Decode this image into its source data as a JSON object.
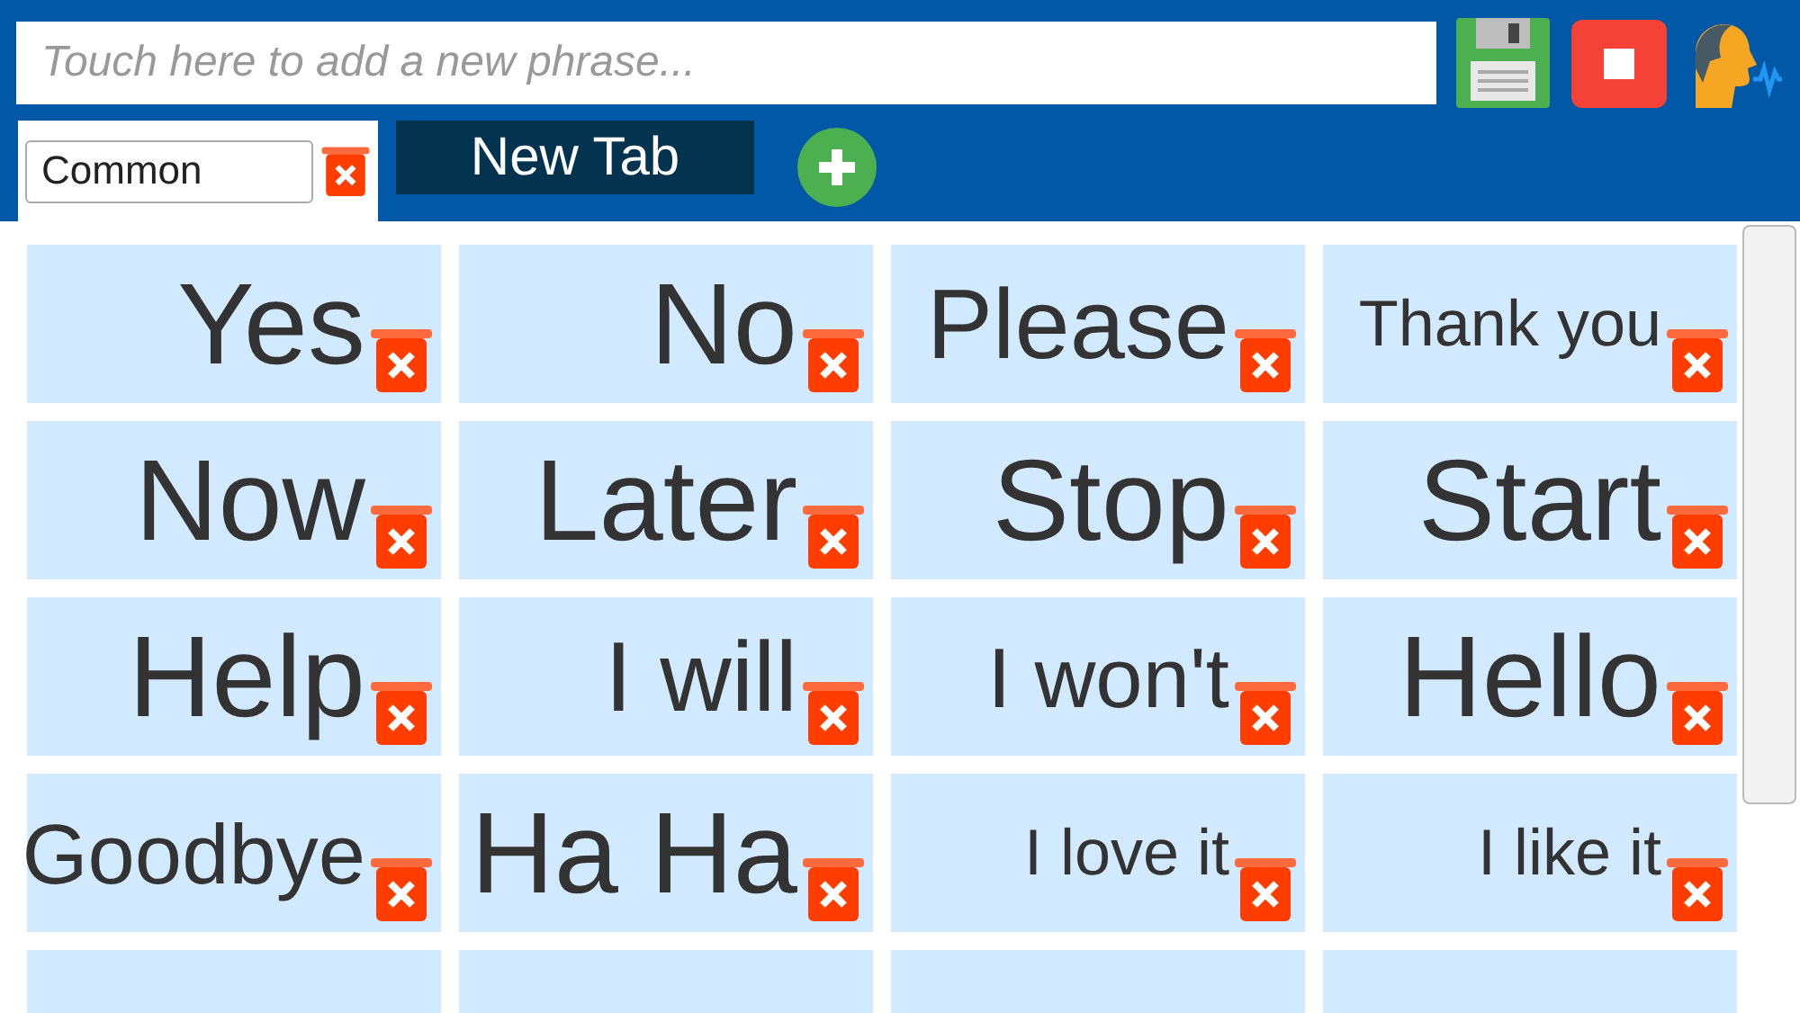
{
  "phrase_input": {
    "placeholder": "Touch here to add a new phrase..."
  },
  "tabs": [
    {
      "label": "Common",
      "selected": true
    },
    {
      "label": "New Tab",
      "selected": false
    }
  ],
  "phrases": [
    "Yes",
    "No",
    "Please",
    "Thank you",
    "Now",
    "Later",
    "Stop",
    "Start",
    "Help",
    "I will",
    "I won't",
    "Hello",
    "Goodbye",
    "Ha Ha",
    "I love it",
    "I like it"
  ]
}
